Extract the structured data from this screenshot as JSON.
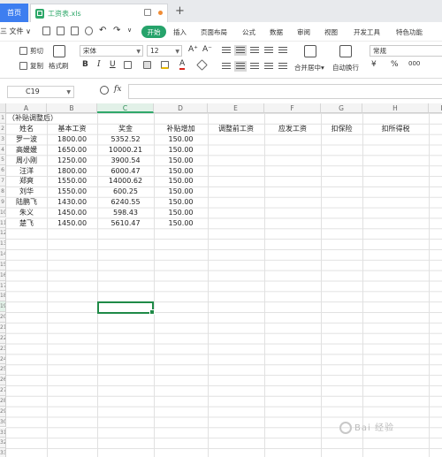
{
  "tabs": {
    "home": "首页",
    "file_name": "工资表.xls"
  },
  "menu": {
    "file": "三 文件 ∨",
    "start": "开始",
    "items": [
      "插入",
      "页面布局",
      "公式",
      "数据",
      "审阅",
      "视图",
      "开发工具",
      "特色功能"
    ]
  },
  "ribbon": {
    "cut": "剪切",
    "copy": "复制",
    "paste": "粘贴",
    "format_painter": "格式刷",
    "font_name": "宋体",
    "font_size": "12",
    "bold": "B",
    "italic": "I",
    "underline": "U",
    "grow": "A⁺",
    "shrink": "A⁻",
    "merge_center": "合并居中",
    "auto_wrap": "自动换行",
    "number_format": "常规",
    "currency": "¥",
    "percent": "%"
  },
  "formula_bar": {
    "cell_ref": "C19",
    "fx": "fx",
    "value": ""
  },
  "columns": [
    "A",
    "B",
    "C",
    "D",
    "E",
    "F",
    "G",
    "H",
    "I"
  ],
  "rows": [
    "1",
    "2",
    "3",
    "4",
    "5",
    "6",
    "7",
    "8",
    "9",
    "10",
    "11",
    "12",
    "13",
    "14",
    "15",
    "16",
    "17",
    "18",
    "19",
    "20",
    "21",
    "22",
    "23",
    "24",
    "25",
    "26",
    "27",
    "28",
    "29",
    "30",
    "31",
    "32",
    "33"
  ],
  "sheet": {
    "title": "（补贴调整后）",
    "headers": [
      "姓名",
      "基本工资",
      "奖金",
      "补贴增加",
      "调整前工资",
      "应发工资",
      "扣保险",
      "扣所得税"
    ],
    "rows": [
      [
        "罗一波",
        "1800.00",
        "5352.52",
        "150.00"
      ],
      [
        "高媛媛",
        "1650.00",
        "10000.21",
        "150.00"
      ],
      [
        "周小刚",
        "1250.00",
        "3900.54",
        "150.00"
      ],
      [
        "汪洋",
        "1800.00",
        "6000.47",
        "150.00"
      ],
      [
        "郑爽",
        "1550.00",
        "14000.62",
        "150.00"
      ],
      [
        "刘华",
        "1550.00",
        "600.25",
        "150.00"
      ],
      [
        "陆鹏飞",
        "1430.00",
        "6240.55",
        "150.00"
      ],
      [
        "朱义",
        "1450.00",
        "598.43",
        "150.00"
      ],
      [
        "楚飞",
        "1450.00",
        "5610.47",
        "150.00"
      ]
    ]
  },
  "watermark": "Bai 经验",
  "colors": {
    "accent_green": "#2fa86a",
    "home_tab_blue": "#3d7ef0",
    "selection_green": "#1f8a47"
  }
}
